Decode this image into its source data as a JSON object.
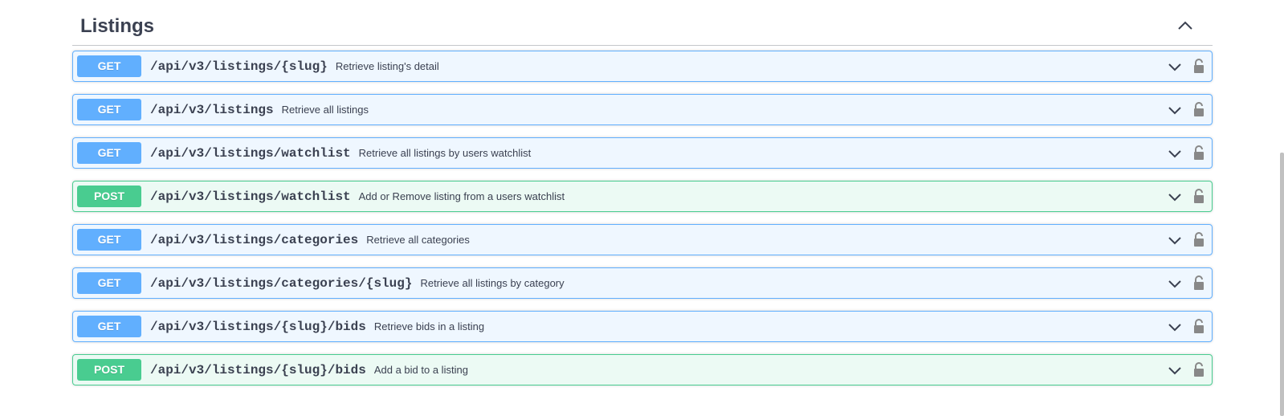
{
  "section": {
    "title": "Listings"
  },
  "operations": [
    {
      "method": "GET",
      "path": "/api/v3/listings/{slug}",
      "summary": "Retrieve listing's detail"
    },
    {
      "method": "GET",
      "path": "/api/v3/listings",
      "summary": "Retrieve all listings"
    },
    {
      "method": "GET",
      "path": "/api/v3/listings/watchlist",
      "summary": "Retrieve all listings by users watchlist"
    },
    {
      "method": "POST",
      "path": "/api/v3/listings/watchlist",
      "summary": "Add or Remove listing from a users watchlist"
    },
    {
      "method": "GET",
      "path": "/api/v3/listings/categories",
      "summary": "Retrieve all categories"
    },
    {
      "method": "GET",
      "path": "/api/v3/listings/categories/{slug}",
      "summary": "Retrieve all listings by category"
    },
    {
      "method": "GET",
      "path": "/api/v3/listings/{slug}/bids",
      "summary": "Retrieve bids in a listing"
    },
    {
      "method": "POST",
      "path": "/api/v3/listings/{slug}/bids",
      "summary": "Add a bid to a listing"
    }
  ],
  "icons": {
    "collapse": "chevron-up-icon",
    "expand": "chevron-down-icon",
    "lock": "lock-icon"
  },
  "colors": {
    "get": "#61affe",
    "post": "#49cc90",
    "text": "#3b4151"
  }
}
